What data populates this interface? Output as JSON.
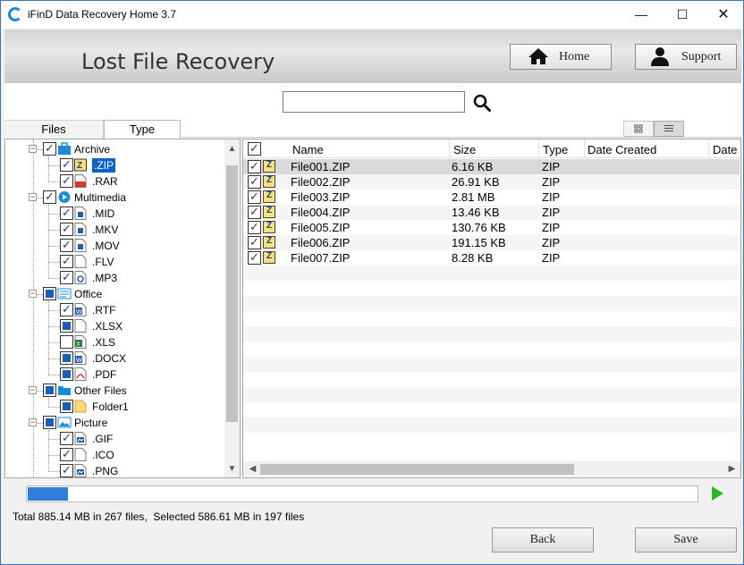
{
  "window": {
    "title": "iFinD Data Recovery Home 3.7",
    "minimize": "—",
    "maximize": "☐",
    "close": "✕"
  },
  "header": {
    "title": "Lost File Recovery",
    "home_label": "Home",
    "support_label": "Support"
  },
  "search": {
    "value": "",
    "placeholder": ""
  },
  "tabs": [
    {
      "label": "Files",
      "active": false
    },
    {
      "label": "Type",
      "active": true
    }
  ],
  "tree": {
    "nodes": [
      {
        "label": "Archive",
        "level": 0,
        "expander": "−",
        "check": "checked",
        "icon": "archive-folder-icon"
      },
      {
        "label": ".ZIP",
        "level": 1,
        "check": "checked",
        "icon": "zip-file-icon",
        "selected": true
      },
      {
        "label": ".RAR",
        "level": 1,
        "check": "checked",
        "icon": "rar-file-icon"
      },
      {
        "label": "Multimedia",
        "level": 0,
        "expander": "−",
        "check": "checked",
        "icon": "multimedia-icon"
      },
      {
        "label": ".MID",
        "level": 1,
        "check": "checked",
        "icon": "media-file-icon"
      },
      {
        "label": ".MKV",
        "level": 1,
        "check": "checked",
        "icon": "media-file-icon"
      },
      {
        "label": ".MOV",
        "level": 1,
        "check": "checked",
        "icon": "media-file-icon"
      },
      {
        "label": ".FLV",
        "level": 1,
        "check": "checked",
        "icon": "blank-file-icon"
      },
      {
        "label": ".MP3",
        "level": 1,
        "check": "checked",
        "icon": "audio-file-icon"
      },
      {
        "label": "Office",
        "level": 0,
        "expander": "−",
        "check": "indeterminate",
        "icon": "office-icon"
      },
      {
        "label": ".RTF",
        "level": 1,
        "check": "checked",
        "icon": "word-file-icon"
      },
      {
        "label": ".XLSX",
        "level": 1,
        "check": "indeterminate",
        "icon": "blank-file-icon"
      },
      {
        "label": ".XLS",
        "level": 1,
        "check": "unchecked",
        "icon": "excel-file-icon"
      },
      {
        "label": ".DOCX",
        "level": 1,
        "check": "indeterminate",
        "icon": "word-file-icon"
      },
      {
        "label": ".PDF",
        "level": 1,
        "check": "indeterminate",
        "icon": "pdf-file-icon"
      },
      {
        "label": "Other Files",
        "level": 0,
        "expander": "−",
        "check": "indeterminate",
        "icon": "folder-icon"
      },
      {
        "label": "Folder1",
        "level": 1,
        "check": "indeterminate",
        "icon": "folder-yellow-icon"
      },
      {
        "label": "Picture",
        "level": 0,
        "expander": "−",
        "check": "indeterminate",
        "icon": "picture-icon"
      },
      {
        "label": ".GIF",
        "level": 1,
        "check": "checked",
        "icon": "image-file-icon"
      },
      {
        "label": ".ICO",
        "level": 1,
        "check": "checked",
        "icon": "blank-file-icon"
      },
      {
        "label": ".PNG",
        "level": 1,
        "check": "checked",
        "icon": "image-file-icon"
      }
    ]
  },
  "grid": {
    "columns": [
      "Name",
      "Size",
      "Type",
      "Date Created",
      "Date"
    ],
    "rows": [
      {
        "name": "File001.ZIP",
        "size": "6.16 KB",
        "type": "ZIP",
        "date_created": ""
      },
      {
        "name": "File002.ZIP",
        "size": "26.91 KB",
        "type": "ZIP",
        "date_created": ""
      },
      {
        "name": "File003.ZIP",
        "size": "2.81 MB",
        "type": "ZIP",
        "date_created": ""
      },
      {
        "name": "File004.ZIP",
        "size": "13.46 KB",
        "type": "ZIP",
        "date_created": ""
      },
      {
        "name": "File005.ZIP",
        "size": "130.76 KB",
        "type": "ZIP",
        "date_created": ""
      },
      {
        "name": "File006.ZIP",
        "size": "191.15 KB",
        "type": "ZIP",
        "date_created": ""
      },
      {
        "name": "File007.ZIP",
        "size": "8.28 KB",
        "type": "ZIP",
        "date_created": ""
      }
    ],
    "icon_letter": "Z"
  },
  "progress": {
    "fraction": 0.06
  },
  "status": {
    "text": "Total 885.14 MB in 267 files,  Selected 586.61 MB in 197 files"
  },
  "footer": {
    "back_label": "Back",
    "save_label": "Save"
  },
  "colors": {
    "accent": "#0a64c8",
    "progress": "#2f7fd8",
    "play": "#2db52d"
  }
}
